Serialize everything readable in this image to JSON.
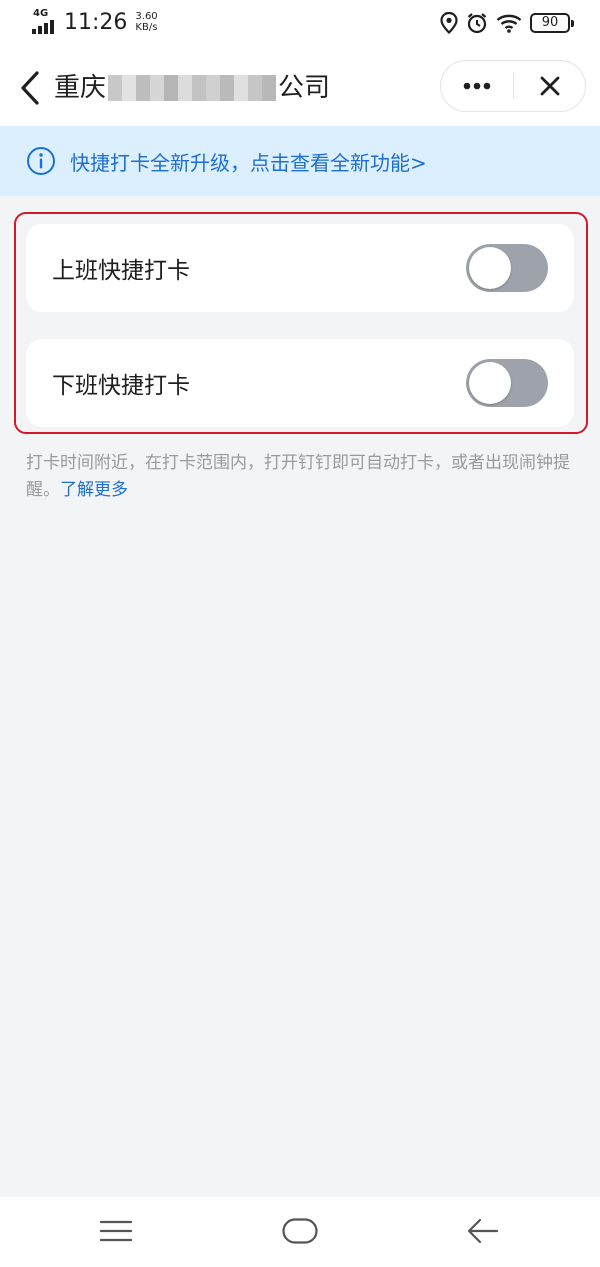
{
  "status_bar": {
    "network_type": "4G",
    "time": "11:26",
    "speed_value": "3.60",
    "speed_unit": "KB/s",
    "battery": "90",
    "icons": [
      "location-icon",
      "alarm-icon",
      "wifi-icon",
      "battery-icon"
    ]
  },
  "nav": {
    "title_prefix": "重庆",
    "title_suffix": "公司",
    "icons": [
      "chevron-left-icon",
      "more-dots-icon",
      "close-icon"
    ]
  },
  "notice": {
    "text": "快捷打卡全新升级，点击查看全新功能>",
    "icon": "info-icon"
  },
  "settings": {
    "items": [
      {
        "label": "上班快捷打卡",
        "enabled": false
      },
      {
        "label": "下班快捷打卡",
        "enabled": false
      }
    ]
  },
  "description": {
    "text": "打卡时间附近，在打卡范围内，打开钉钉即可自动打卡，或者出现闹钟提醒。",
    "link": "了解更多"
  },
  "bottom_nav": {
    "icons": [
      "menu-icon",
      "home-icon",
      "back-arrow-icon"
    ]
  },
  "colors": {
    "accent": "#1d6fd6",
    "notice_bg": "#dcefff",
    "highlight": "#d3182b",
    "toggle_off": "#9ea3ab",
    "page_bg": "#f3f4f6"
  }
}
